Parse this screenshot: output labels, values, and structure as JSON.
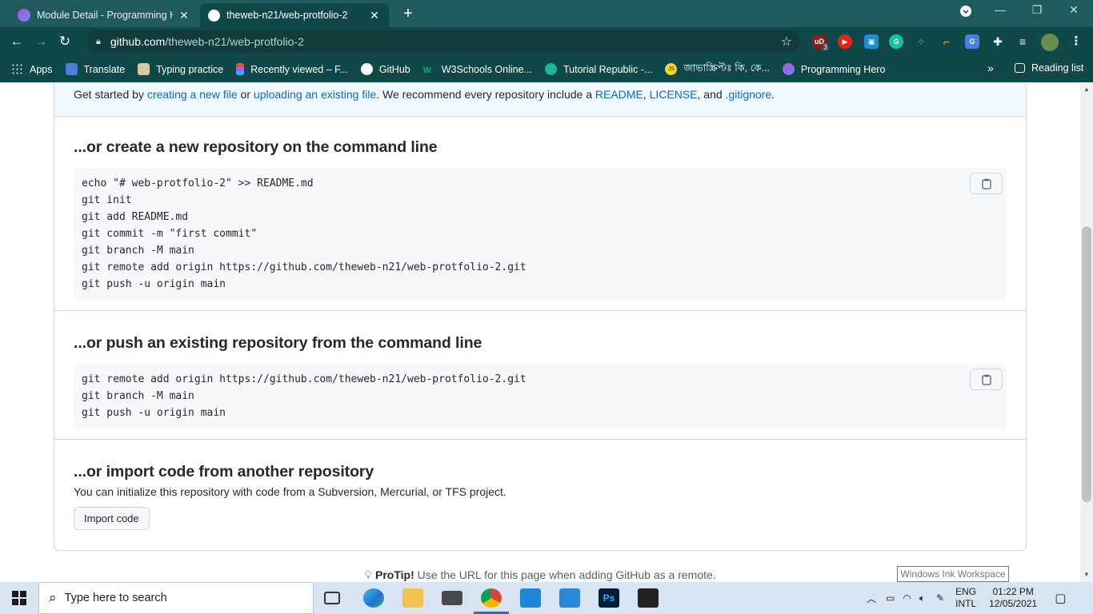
{
  "browser": {
    "tabs": [
      {
        "title": "Module Detail - Programming He",
        "active": false
      },
      {
        "title": "theweb-n21/web-protfolio-2",
        "active": true
      }
    ],
    "url_host": "github.com",
    "url_path": "/theweb-n21/web-protfolio-2",
    "extension_badge": "3",
    "bookmarks": [
      {
        "label": "Apps",
        "icon": "apps-grid-icon"
      },
      {
        "label": "Translate",
        "icon": "translate-icon"
      },
      {
        "label": "Typing practice",
        "icon": "keyboard-icon"
      },
      {
        "label": "Recently viewed – F...",
        "icon": "figma-icon"
      },
      {
        "label": "GitHub",
        "icon": "github-icon"
      },
      {
        "label": "W3Schools Online...",
        "icon": "w3schools-icon"
      },
      {
        "label": "Tutorial Republic -...",
        "icon": "tutorial-republic-icon"
      },
      {
        "label": "জাভাস্ক্রিপ্টঃ কি, কে...",
        "icon": "js-icon"
      },
      {
        "label": "Programming Hero",
        "icon": "programming-hero-icon"
      }
    ],
    "more_bookmarks": "»",
    "reading_list": "Reading list"
  },
  "page": {
    "setup": {
      "prefix": "Get started by ",
      "link1": "creating a new file",
      "or": " or ",
      "link2": "uploading an existing file",
      "middle": ". We recommend every repository include a ",
      "link3": "README",
      "comma": ", ",
      "link4": "LICENSE",
      "and": ", and ",
      "link5": ".gitignore",
      "end": "."
    },
    "create_section": {
      "heading": "...or create a new repository on the command line",
      "lines": [
        "echo \"# web-protfolio-2\" >> README.md",
        "git init",
        "git add README.md",
        "git commit -m \"first commit\"",
        "git branch -M main",
        "git remote add origin https://github.com/theweb-n21/web-protfolio-2.git",
        "git push -u origin main"
      ]
    },
    "push_section": {
      "heading": "...or push an existing repository from the command line",
      "lines": [
        "git remote add origin https://github.com/theweb-n21/web-protfolio-2.git",
        "git branch -M main",
        "git push -u origin main"
      ]
    },
    "import_section": {
      "heading": "...or import code from another repository",
      "text": "You can initialize this repository with code from a Subversion, Mercurial, or TFS project.",
      "button": "Import code"
    },
    "protip": {
      "label": "ProTip!",
      "text": " Use the URL for this page when adding GitHub as a remote."
    }
  },
  "tooltip": "Windows Ink Workspace",
  "taskbar": {
    "search_placeholder": "Type here to search",
    "language": "ENG",
    "layout": "INTL",
    "time": "01:22 PM",
    "date": "12/05/2021"
  },
  "colors": {
    "chrome_frame": "#1f5a5c",
    "chrome_toolbar": "#0f4848",
    "link": "#0969da",
    "border": "#d0d7de",
    "code_bg": "#f6f8fa",
    "taskbar": "#d9e4f2"
  }
}
